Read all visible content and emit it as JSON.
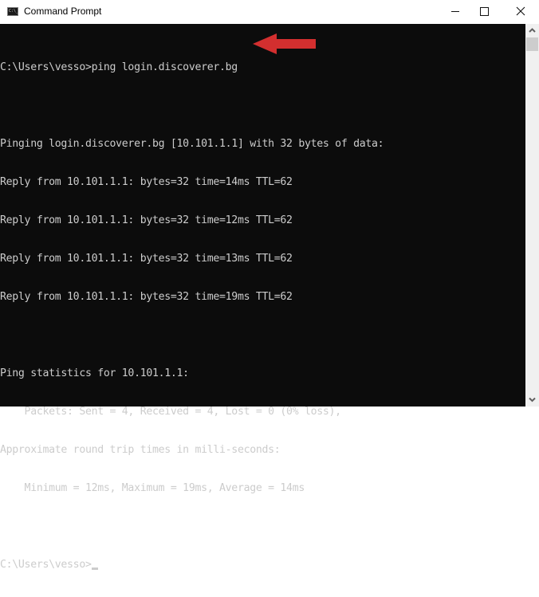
{
  "window": {
    "title": "Command Prompt",
    "icon": "cmd-icon",
    "icon_text": "C:\\_",
    "controls": {
      "minimize": "minimize-icon",
      "maximize": "maximize-icon",
      "close": "close-icon"
    }
  },
  "console": {
    "background": "#0c0c0c",
    "foreground": "#cccccc",
    "lines": [
      "C:\\Users\\vesso>ping login.discoverer.bg",
      "",
      "Pinging login.discoverer.bg [10.101.1.1] with 32 bytes of data:",
      "Reply from 10.101.1.1: bytes=32 time=14ms TTL=62",
      "Reply from 10.101.1.1: bytes=32 time=12ms TTL=62",
      "Reply from 10.101.1.1: bytes=32 time=13ms TTL=62",
      "Reply from 10.101.1.1: bytes=32 time=19ms TTL=62",
      "",
      "Ping statistics for 10.101.1.1:",
      "    Packets: Sent = 4, Received = 4, Lost = 0 (0% loss),",
      "Approximate round trip times in milli-seconds:",
      "    Minimum = 12ms, Maximum = 19ms, Average = 14ms",
      "",
      "C:\\Users\\vesso>"
    ],
    "annotation": {
      "type": "arrow",
      "direction": "left",
      "color": "#d32f2f",
      "points_to_line": 0
    }
  },
  "scrollbar": {
    "up": "scroll-up-icon",
    "down": "scroll-down-icon"
  }
}
